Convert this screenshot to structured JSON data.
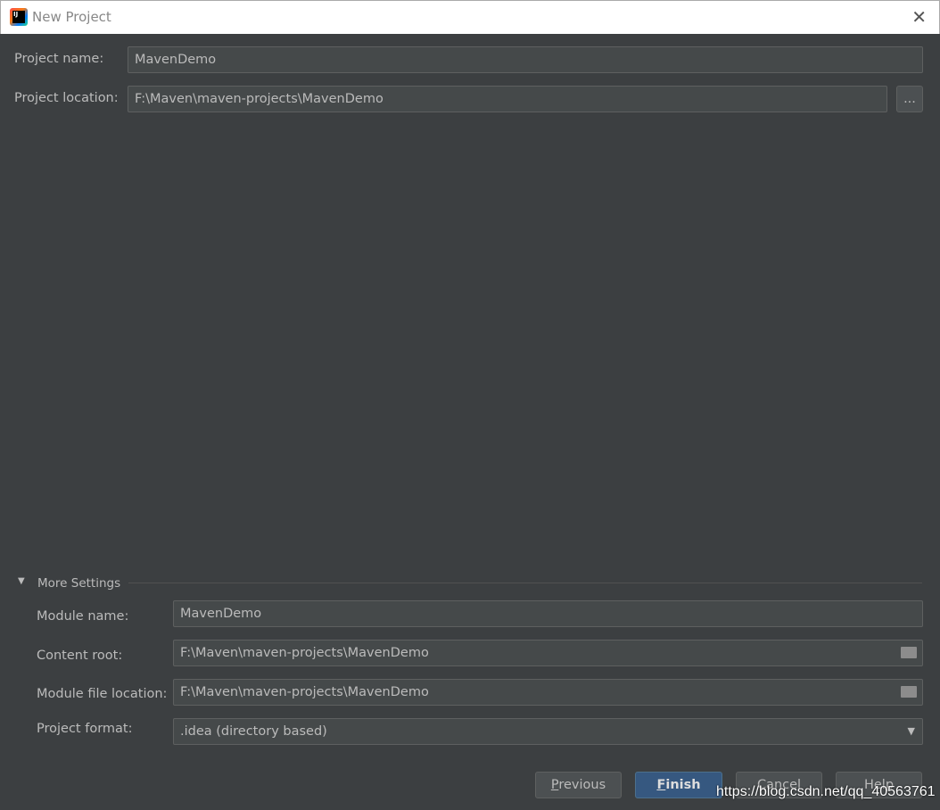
{
  "window": {
    "title": "New Project",
    "logo_text": "IJ",
    "close": "✕"
  },
  "project": {
    "name_label": "Project name:",
    "name_value": "MavenDemo",
    "location_label": "Project location:",
    "location_value": "F:\\Maven\\maven-projects\\MavenDemo",
    "browse": "..."
  },
  "more_settings": {
    "label": "More Settings",
    "expanded": true,
    "module_name_label": "Module name:",
    "module_name_value": "MavenDemo",
    "content_root_label": "Content root:",
    "content_root_value": "F:\\Maven\\maven-projects\\MavenDemo",
    "module_file_label": "Module file location:",
    "module_file_value": "F:\\Maven\\maven-projects\\MavenDemo",
    "format_label": "Project format:",
    "format_value": ".idea (directory based)"
  },
  "buttons": {
    "previous_first": "P",
    "previous_rest": "revious",
    "finish_first": "F",
    "finish_rest": "inish",
    "cancel": "Cancel",
    "help": "Help"
  },
  "watermark": "https://blog.csdn.net/qq_40563761"
}
